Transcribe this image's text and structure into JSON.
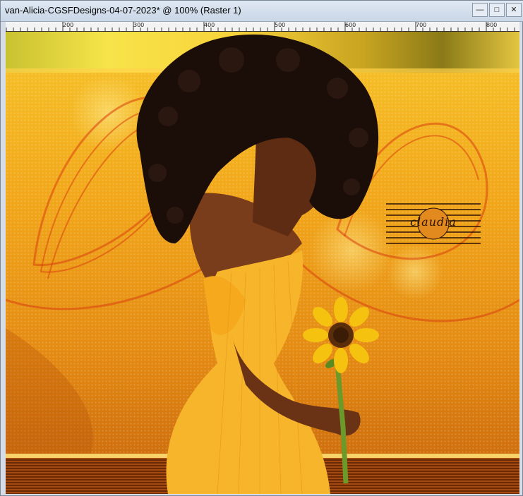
{
  "window": {
    "title": "van-Alicia-CGSFDesigns-04-07-2023* @ 100% (Raster 1)",
    "buttons": [
      "minimize",
      "maximize",
      "close"
    ]
  },
  "ruler": {
    "labels": [
      "200",
      "300",
      "400",
      "500",
      "600",
      "700",
      "800"
    ]
  },
  "canvas": {
    "watermark_text": "claudia",
    "colors": {
      "background_top": "#f6c42a",
      "background_bottom": "#c7650b",
      "dress": "#f7b52c",
      "hair": "#1b0e09",
      "skin": "#7a3d1c",
      "sunflower": "#f5c20f"
    }
  }
}
